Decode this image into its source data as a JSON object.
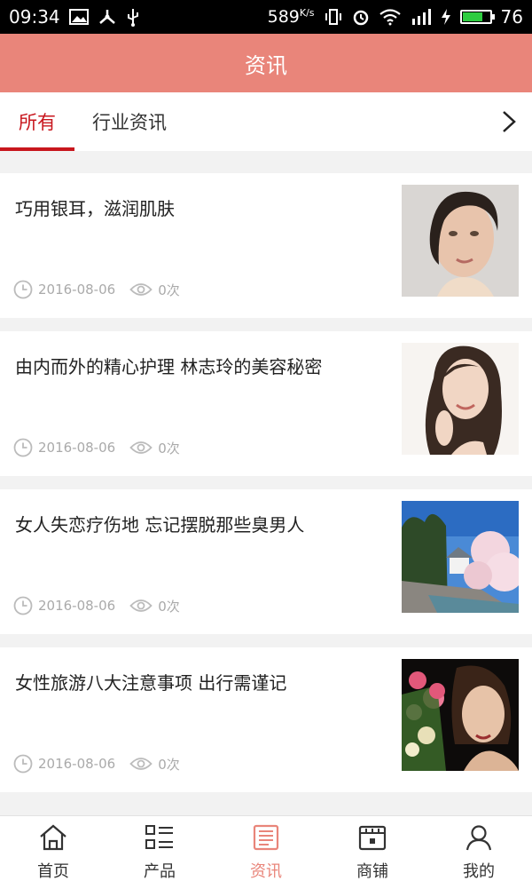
{
  "status_bar": {
    "time": "09:34",
    "speed": "589",
    "speed_unit": "K/s",
    "battery": "76",
    "battery_level": 0.76
  },
  "header": {
    "title": "资讯"
  },
  "tabs": [
    {
      "label": "所有",
      "active": true
    },
    {
      "label": "行业资讯",
      "active": false
    }
  ],
  "news": [
    {
      "title": "巧用银耳，滋润肌肤",
      "date": "2016-08-06",
      "views": "0次"
    },
    {
      "title": "由内而外的精心护理 林志玲的美容秘密",
      "date": "2016-08-06",
      "views": "0次"
    },
    {
      "title": "女人失恋疗伤地 忘记摆脱那些臭男人",
      "date": "2016-08-06",
      "views": "0次"
    },
    {
      "title": "女性旅游八大注意事项 出行需谨记",
      "date": "2016-08-06",
      "views": "0次"
    }
  ],
  "bottom_nav": [
    {
      "label": "首页",
      "icon": "home-icon"
    },
    {
      "label": "产品",
      "icon": "product-list-icon"
    },
    {
      "label": "资讯",
      "icon": "news-icon",
      "active": true
    },
    {
      "label": "商铺",
      "icon": "store-icon"
    },
    {
      "label": "我的",
      "icon": "user-icon"
    }
  ],
  "colors": {
    "header": "#e9857a",
    "tab_active": "#c8161d",
    "nav_active": "#e9857a"
  }
}
